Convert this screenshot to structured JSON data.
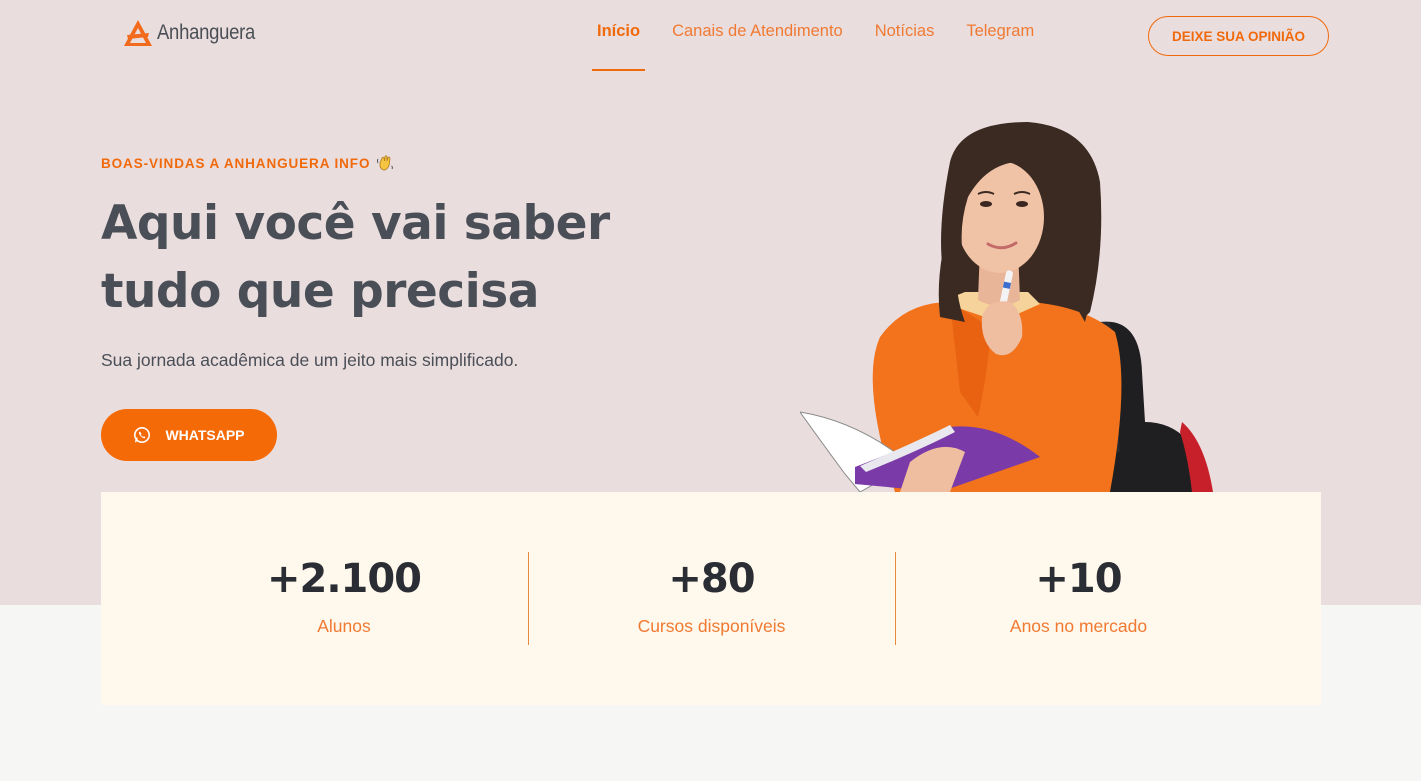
{
  "brand": {
    "name": "Anhanguera",
    "logo_icon": "anhanguera-triangle-logo"
  },
  "nav": {
    "items": [
      {
        "label": "Início",
        "active": true
      },
      {
        "label": "Canais de Atendimento",
        "active": false
      },
      {
        "label": "Notícias",
        "active": false
      },
      {
        "label": "Telegram",
        "active": false
      }
    ],
    "cta_label": "DEIXE SUA OPINIÃO"
  },
  "hero": {
    "eyebrow": "BOAS-VINDAS A ANHANGUERA INFO",
    "eyebrow_icon": "waving-hand-emoji",
    "headline_line1": "Aqui você vai saber",
    "headline_line2": "tudo que precisa",
    "subline": "Sua jornada acadêmica de um jeito mais simplificado.",
    "whatsapp_label": "WHATSAPP",
    "whatsapp_icon": "whatsapp-icon"
  },
  "stats": [
    {
      "value": "+2.100",
      "label": "Alunos"
    },
    {
      "value": "+80",
      "label": "Cursos disponíveis"
    },
    {
      "value": "+10",
      "label": "Anos no mercado"
    }
  ],
  "colors": {
    "accent": "#f06a0c",
    "hero_background": "#eaddde",
    "stats_background": "#fff8ec",
    "text_dark": "#4a4f57"
  }
}
